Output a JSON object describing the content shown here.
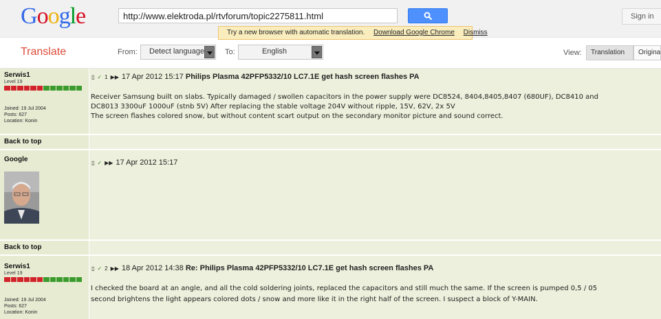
{
  "header": {
    "logo_text": "Google",
    "url": "http://www.elektroda.pl/rtvforum/topic2275811.html",
    "sign_in": "Sign in"
  },
  "notice": {
    "text": "Try a new browser with automatic translation.",
    "link": "Download Google Chrome",
    "dismiss": "Dismiss"
  },
  "translate_bar": {
    "title": "Translate",
    "from_label": "From:",
    "from_value": "Detect language",
    "to_label": "To:",
    "to_value": "English",
    "view_label": "View:",
    "translation_btn": "Translation",
    "original_btn": "Original"
  },
  "posts": [
    {
      "user": "Serwis1",
      "level": "Level 19",
      "joined": "Joined: 19 Jul 2004",
      "posts": "Posts: 627",
      "location": "Location: Konin",
      "num": "1",
      "date": "17 Apr 2012 15:17",
      "subject": "Philips Plasma 42PFP5332/10 LC7.1E get hash screen flashes PA",
      "body": [
        "Receiver Samsung built on slabs. Typically damaged / swollen capacitors in the power supply were DC8524, 8404,8405,8407 (680UF), DC8410 and",
        "DC8013 3300uF 1000uF (stnb 5V) After replacing the stable voltage 204V without ripple, 15V, 62V, 2x 5V",
        "The screen flashes colored snow, but without content scart output on the secondary monitor picture and sound correct."
      ]
    },
    {
      "user": "Google",
      "date": "17 Apr 2012 15:17"
    },
    {
      "user": "Serwis1",
      "level": "Level 19",
      "joined": "Joined: 19 Jul 2004",
      "posts": "Posts: 627",
      "location": "Location: Konin",
      "num": "2",
      "date": "18 Apr 2012 14:38",
      "subject": "Re: Philips Plasma 42PFP5332/10 LC7.1E get hash screen flashes PA",
      "body": [
        "I checked the board at an angle, and all the cold soldering joints, replaced the capacitors and still much the same. If the screen is pumped 0,5 / 05",
        "second brightens the light appears colored dots / snow and more like it in the right half of the screen. I suspect a block of Y-MAIN."
      ]
    }
  ],
  "back_to_top": "Back to top",
  "colors": {
    "accent_red": "#dd4b39",
    "blue_button": "#4d90fe",
    "notice_bg": "#f9edbe"
  }
}
